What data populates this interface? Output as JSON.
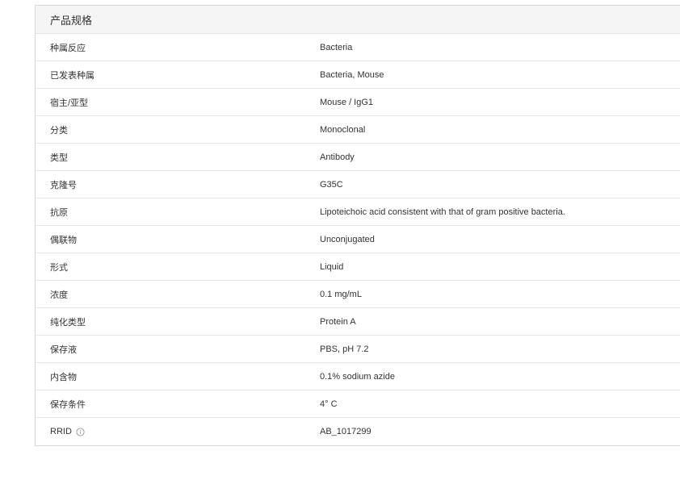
{
  "spec": {
    "title": "产品规格",
    "rows": [
      {
        "label": "种属反应",
        "value": "Bacteria"
      },
      {
        "label": "已发表种属",
        "value": "Bacteria, Mouse"
      },
      {
        "label": "宿主/亚型",
        "value": "Mouse / IgG1"
      },
      {
        "label": "分类",
        "value": "Monoclonal"
      },
      {
        "label": "类型",
        "value": "Antibody"
      },
      {
        "label": "克隆号",
        "value": "G35C"
      },
      {
        "label": "抗原",
        "value": "Lipoteichoic acid consistent with that of gram positive bacteria."
      },
      {
        "label": "偶联物",
        "value": "Unconjugated"
      },
      {
        "label": "形式",
        "value": "Liquid"
      },
      {
        "label": "浓度",
        "value": "0.1 mg/mL"
      },
      {
        "label": "纯化类型",
        "value": "Protein A"
      },
      {
        "label": "保存液",
        "value": "PBS, pH 7.2"
      },
      {
        "label": "内含物",
        "value": "0.1% sodium azide"
      },
      {
        "label": "保存条件",
        "value": "4° C"
      },
      {
        "label": "RRID",
        "value": "AB_1017299",
        "icon": "info-circle-icon"
      }
    ]
  },
  "colors": {
    "text": "#333333",
    "header_bg": "#f5f5f5",
    "border": "#d8d8d8",
    "icon": "#999999"
  }
}
